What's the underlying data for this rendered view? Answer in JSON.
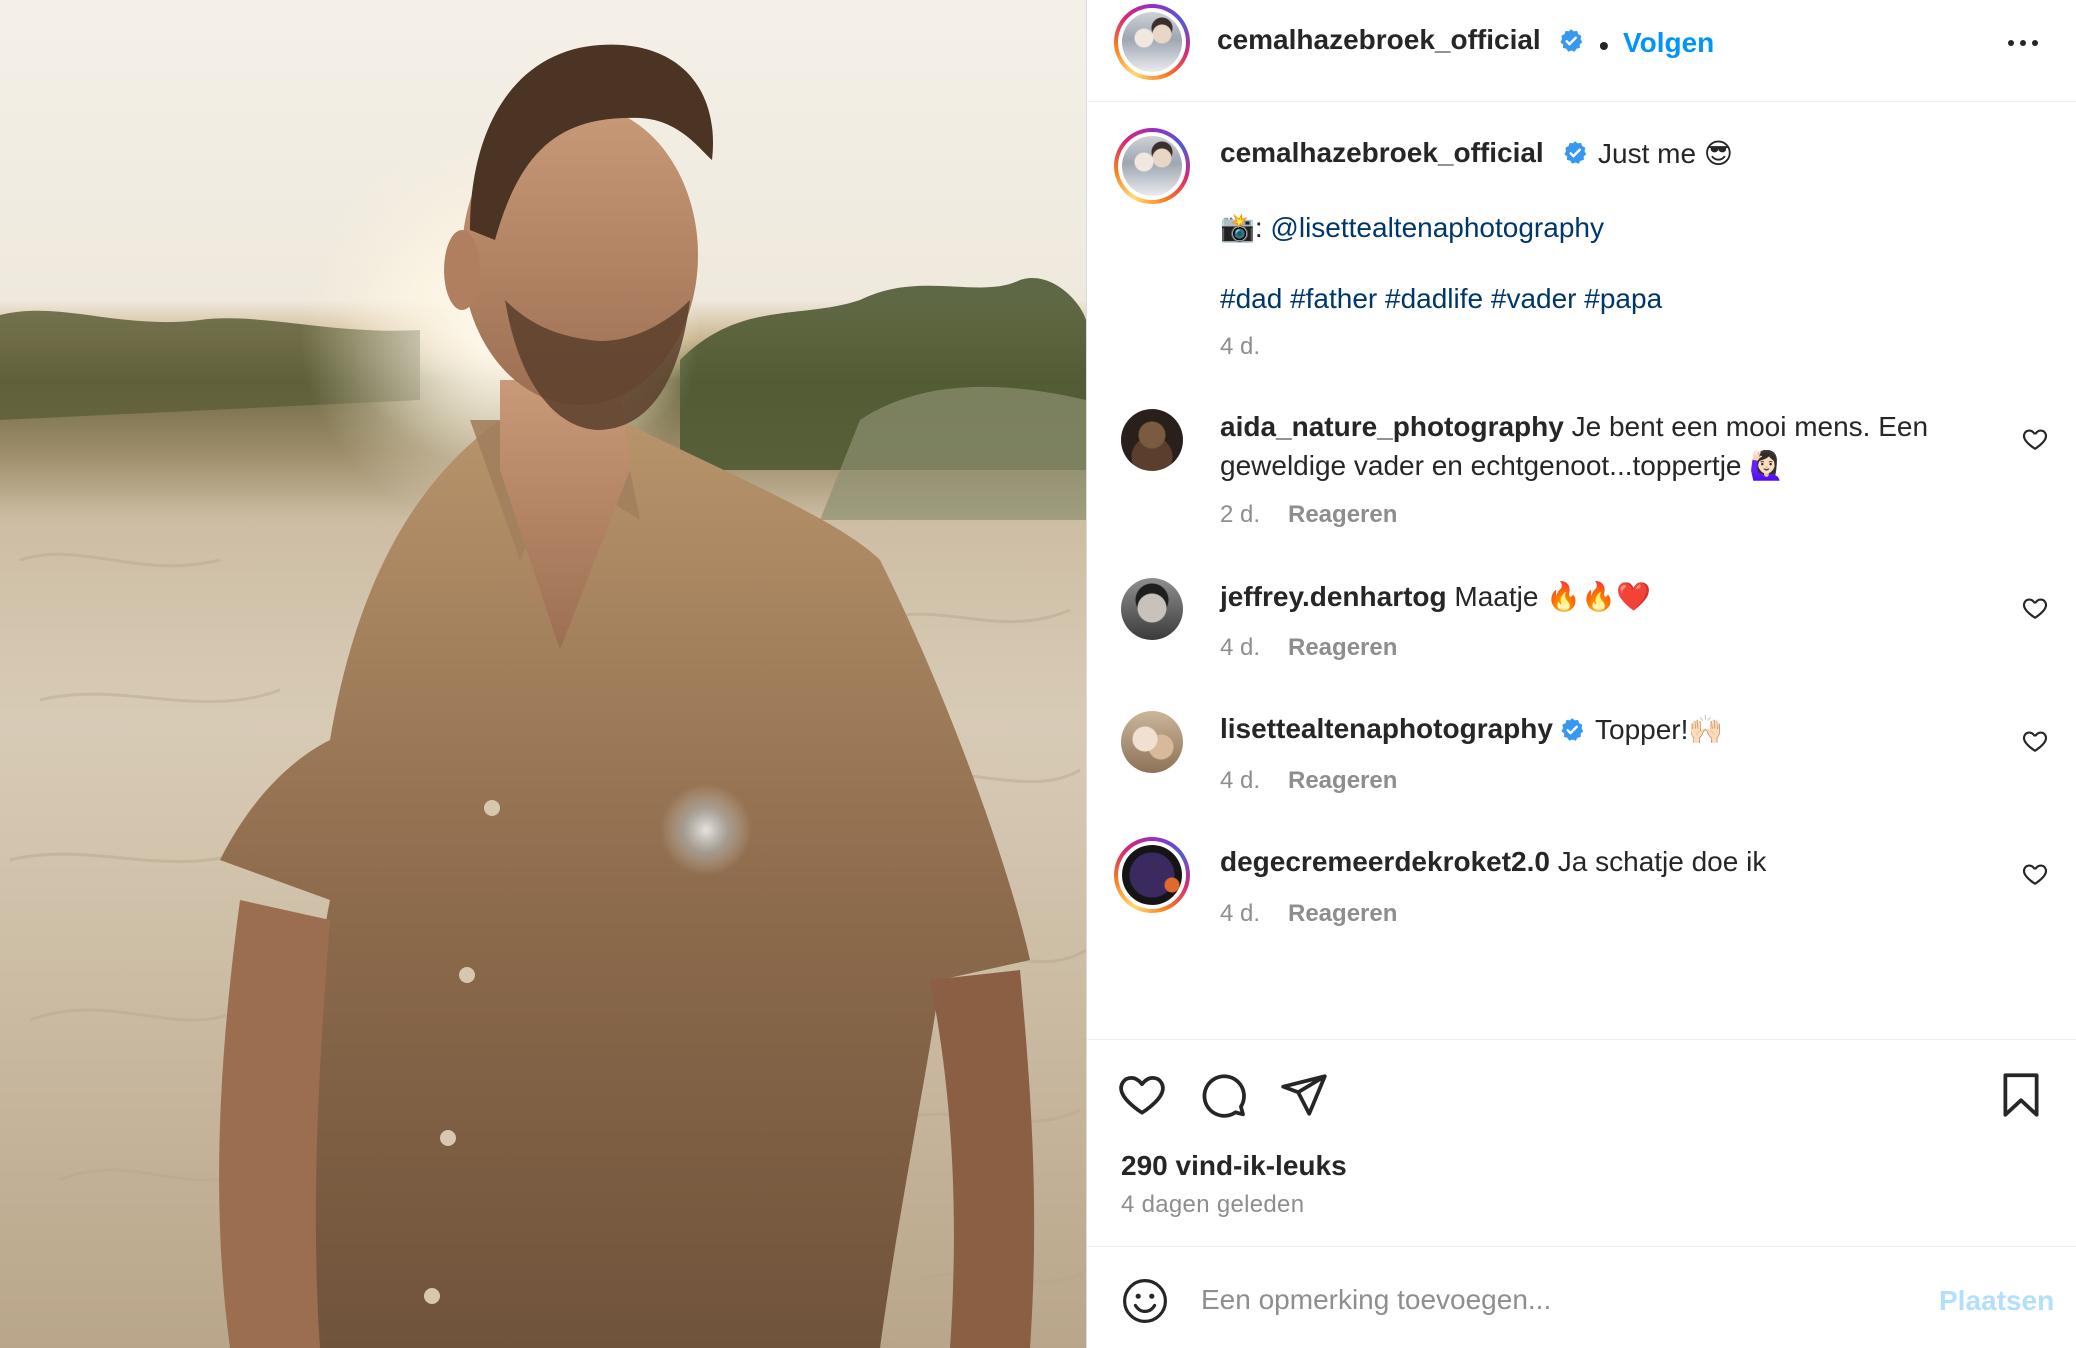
{
  "post": {
    "username": "cemalhazebroek_official",
    "follow_label": "Volgen",
    "separator": "•",
    "caption": {
      "text": "Just me 😎",
      "credit_prefix": "📸: ",
      "credit_mention": "@lisettealtenaphotography",
      "hashtags": "#dad #father #dadlife #vader #papa",
      "age": "4 d."
    },
    "comments": [
      {
        "username": "aida_nature_photography",
        "verified": false,
        "text_line1": "Je bent een mooi mens. Een",
        "text_line2": "geweldige vader en echtgenoot...toppertje 🙋🏻‍♀️",
        "age": "2 d.",
        "reply_label": "Reageren"
      },
      {
        "username": "jeffrey.denhartog",
        "verified": false,
        "text_line1": "Maatje 🔥🔥❤️",
        "age": "4 d.",
        "reply_label": "Reageren"
      },
      {
        "username": "lisettealtenaphotography",
        "verified": true,
        "text_line1": "Topper!🙌🏻",
        "age": "4 d.",
        "reply_label": "Reageren"
      },
      {
        "username": "degecremeerdekroket2.0",
        "verified": false,
        "text_line1": "Ja schatje doe ik",
        "age": "4 d.",
        "reply_label": "Reageren"
      }
    ],
    "likes": "290 vind-ik-leuks",
    "date": "4 dagen geleden",
    "comment_box": {
      "placeholder": "Een opmerking toevoegen...",
      "post_label": "Plaatsen"
    }
  },
  "icons": [
    "more-icon",
    "verified-icon",
    "heart-icon",
    "comment-icon",
    "share-icon",
    "bookmark-icon",
    "emoji-icon"
  ],
  "colors": {
    "accent": "#0095f6",
    "link": "#00376b",
    "muted": "#8e8e8e",
    "post_disabled": "#b2dffc",
    "verified": "#3897f0"
  }
}
